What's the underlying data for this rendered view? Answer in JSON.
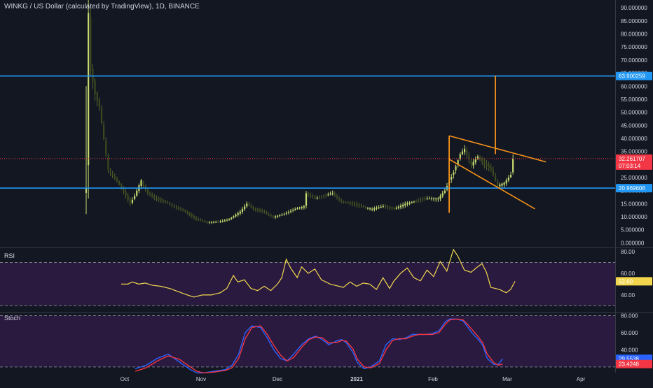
{
  "header": {
    "title": "WINKG / US Dollar (calculated by TradingView), 1D, BINANCE"
  },
  "panes": {
    "rsi_label": "RSI",
    "stoch_label": "Stoch"
  },
  "colors": {
    "background": "#131722",
    "bull": "#c5d86d",
    "bear": "#3b4a1e",
    "axis_text": "#d1d4dc",
    "hline": "#2196f3",
    "trend": "#f7931a",
    "current_price": "#f23645",
    "rsi_line": "#f2d74e",
    "osc_band": "#2a1a3f",
    "stoch_k": "#2962ff",
    "stoch_d": "#f23645"
  },
  "chart_data": [
    {
      "type": "candlestick",
      "title": "WINKG / US Dollar (calculated by TradingView), 1D, BINANCE",
      "ylim": [
        -1.5,
        93
      ],
      "x_ticks": [
        "Oct",
        "Nov",
        "Dec",
        "2021",
        "Feb",
        "Mar",
        "Apr"
      ],
      "y_ticks": [
        "90.000000",
        "85.000000",
        "80.000000",
        "75.000000",
        "70.000000",
        "65.000000",
        "60.000000",
        "55.000000",
        "50.000000",
        "45.000000",
        "40.000000",
        "35.000000",
        "30.000000",
        "25.000000",
        "20.000000",
        "15.000000",
        "10.000000",
        "5.000000",
        "0.000000"
      ],
      "close_anchors": [
        [
          0,
          21
        ],
        [
          1,
          88
        ],
        [
          2,
          66
        ],
        [
          4,
          57
        ],
        [
          6,
          52
        ],
        [
          8,
          40
        ],
        [
          10,
          28
        ],
        [
          13,
          25
        ],
        [
          16,
          21
        ],
        [
          18,
          18
        ],
        [
          20,
          15
        ],
        [
          22,
          18
        ],
        [
          25,
          24
        ],
        [
          28,
          19
        ],
        [
          31,
          17
        ],
        [
          35,
          16
        ],
        [
          40,
          14
        ],
        [
          45,
          12
        ],
        [
          50,
          9
        ],
        [
          55,
          8
        ],
        [
          60,
          8
        ],
        [
          65,
          9
        ],
        [
          70,
          12
        ],
        [
          73,
          15
        ],
        [
          76,
          13
        ],
        [
          80,
          12
        ],
        [
          85,
          10
        ],
        [
          90,
          11
        ],
        [
          95,
          13
        ],
        [
          99,
          14
        ],
        [
          100,
          19
        ],
        [
          104,
          17
        ],
        [
          108,
          18
        ],
        [
          112,
          19
        ],
        [
          116,
          16
        ],
        [
          120,
          15
        ],
        [
          125,
          14
        ],
        [
          130,
          13
        ],
        [
          135,
          14
        ],
        [
          140,
          13
        ],
        [
          145,
          15
        ],
        [
          150,
          16
        ],
        [
          155,
          17
        ],
        [
          160,
          17
        ],
        [
          163,
          20
        ],
        [
          167,
          27
        ],
        [
          170,
          34
        ],
        [
          172,
          36
        ],
        [
          175,
          30
        ],
        [
          178,
          33
        ],
        [
          181,
          30
        ],
        [
          184,
          28
        ],
        [
          187,
          22
        ],
        [
          190,
          23
        ],
        [
          193,
          26
        ],
        [
          194,
          32.26
        ]
      ],
      "high_anchors": [
        [
          0,
          60
        ],
        [
          1,
          94
        ],
        [
          2,
          90
        ]
      ],
      "low_anchors": [
        [
          0,
          11
        ],
        [
          1,
          17
        ]
      ],
      "horizontal_levels": [
        {
          "price": 63.900259,
          "label": "63.900259"
        },
        {
          "price": 20.969606,
          "label": "20.969606"
        }
      ],
      "current_price": {
        "price": 32.261707,
        "label": "32.261707",
        "countdown": "07:03:14"
      },
      "trend_lines": [
        {
          "from": [
            165,
            41
          ],
          "to": [
            209,
            31
          ]
        },
        {
          "from": [
            165,
            32
          ],
          "to": [
            204,
            13
          ]
        }
      ],
      "vertical_lines": [
        {
          "x": 165,
          "from": 11.5,
          "to": 41
        },
        {
          "x": 186,
          "from": 34,
          "to": 64
        }
      ]
    },
    {
      "type": "line",
      "name": "RSI",
      "ylim": [
        25,
        82
      ],
      "y_ticks": [
        "80.00",
        "60.00",
        "40.00"
      ],
      "levels": [
        70,
        30
      ],
      "value_label": "52.60",
      "anchors": [
        [
          0,
          50
        ],
        [
          3,
          50
        ],
        [
          5,
          52
        ],
        [
          8,
          50
        ],
        [
          11,
          51
        ],
        [
          14,
          49
        ],
        [
          18,
          48
        ],
        [
          22,
          46
        ],
        [
          26,
          43
        ],
        [
          30,
          40
        ],
        [
          33,
          38
        ],
        [
          37,
          40
        ],
        [
          41,
          40
        ],
        [
          45,
          42
        ],
        [
          48,
          46
        ],
        [
          51,
          58
        ],
        [
          53,
          52
        ],
        [
          56,
          54
        ],
        [
          59,
          46
        ],
        [
          62,
          44
        ],
        [
          65,
          48
        ],
        [
          68,
          44
        ],
        [
          71,
          50
        ],
        [
          73,
          56
        ],
        [
          75,
          73
        ],
        [
          77,
          65
        ],
        [
          80,
          56
        ],
        [
          82,
          66
        ],
        [
          85,
          60
        ],
        [
          88,
          64
        ],
        [
          91,
          54
        ],
        [
          95,
          50
        ],
        [
          99,
          48
        ],
        [
          101,
          47
        ],
        [
          104,
          52
        ],
        [
          107,
          48
        ],
        [
          110,
          51
        ],
        [
          113,
          50
        ],
        [
          116,
          45
        ],
        [
          119,
          56
        ],
        [
          122,
          46
        ],
        [
          124,
          53
        ],
        [
          127,
          60
        ],
        [
          130,
          65
        ],
        [
          133,
          56
        ],
        [
          136,
          53
        ],
        [
          139,
          63
        ],
        [
          142,
          57
        ],
        [
          145,
          71
        ],
        [
          148,
          62
        ],
        [
          151,
          82
        ],
        [
          153,
          76
        ],
        [
          156,
          63
        ],
        [
          159,
          61
        ],
        [
          162,
          66
        ],
        [
          164,
          69
        ],
        [
          166,
          61
        ],
        [
          168,
          47
        ],
        [
          170,
          46
        ],
        [
          172,
          45
        ],
        [
          175,
          42
        ],
        [
          177,
          45
        ],
        [
          179,
          52.6
        ]
      ]
    },
    {
      "type": "line",
      "name": "Stoch",
      "ylim": [
        15,
        82
      ],
      "y_ticks": [
        "80.000",
        "60.000",
        "40.000"
      ],
      "levels": [
        80,
        20
      ],
      "k_label": "29.5538",
      "d_label": "23.4248",
      "k_anchors": [
        [
          0,
          18
        ],
        [
          5,
          22
        ],
        [
          10,
          30
        ],
        [
          15,
          35
        ],
        [
          20,
          26
        ],
        [
          25,
          17
        ],
        [
          28,
          13
        ],
        [
          31,
          13
        ],
        [
          36,
          15
        ],
        [
          41,
          17
        ],
        [
          44,
          22
        ],
        [
          47,
          35
        ],
        [
          50,
          60
        ],
        [
          53,
          68
        ],
        [
          57,
          66
        ],
        [
          60,
          54
        ],
        [
          63,
          40
        ],
        [
          66,
          30
        ],
        [
          69,
          27
        ],
        [
          72,
          35
        ],
        [
          76,
          47
        ],
        [
          79,
          53
        ],
        [
          82,
          56
        ],
        [
          85,
          52
        ],
        [
          88,
          46
        ],
        [
          92,
          51
        ],
        [
          94,
          52
        ],
        [
          96,
          48
        ],
        [
          99,
          37
        ],
        [
          101,
          25
        ],
        [
          104,
          18
        ],
        [
          107,
          20
        ],
        [
          111,
          27
        ],
        [
          114,
          46
        ],
        [
          117,
          53
        ],
        [
          120,
          52
        ],
        [
          123,
          54
        ],
        [
          126,
          58
        ],
        [
          129,
          58
        ],
        [
          132,
          58
        ],
        [
          135,
          59
        ],
        [
          138,
          62
        ],
        [
          141,
          73
        ],
        [
          143,
          76
        ],
        [
          146,
          76
        ],
        [
          149,
          74
        ],
        [
          151,
          67
        ],
        [
          153,
          60
        ],
        [
          156,
          52
        ],
        [
          158,
          45
        ],
        [
          160,
          30
        ],
        [
          163,
          23
        ],
        [
          165,
          23
        ],
        [
          167,
          29.55
        ]
      ],
      "d_anchors": [
        [
          0,
          15
        ],
        [
          5,
          19
        ],
        [
          10,
          27
        ],
        [
          15,
          33
        ],
        [
          20,
          29
        ],
        [
          25,
          20
        ],
        [
          28,
          15
        ],
        [
          31,
          13
        ],
        [
          36,
          14
        ],
        [
          41,
          16
        ],
        [
          44,
          19
        ],
        [
          47,
          30
        ],
        [
          50,
          53
        ],
        [
          53,
          66
        ],
        [
          57,
          68
        ],
        [
          60,
          58
        ],
        [
          63,
          45
        ],
        [
          66,
          34
        ],
        [
          69,
          27
        ],
        [
          72,
          31
        ],
        [
          76,
          44
        ],
        [
          79,
          52
        ],
        [
          82,
          55
        ],
        [
          85,
          54
        ],
        [
          88,
          48
        ],
        [
          92,
          49
        ],
        [
          94,
          51
        ],
        [
          96,
          50
        ],
        [
          99,
          41
        ],
        [
          101,
          29
        ],
        [
          104,
          20
        ],
        [
          107,
          19
        ],
        [
          111,
          24
        ],
        [
          114,
          40
        ],
        [
          117,
          51
        ],
        [
          120,
          53
        ],
        [
          123,
          53
        ],
        [
          126,
          56
        ],
        [
          129,
          58
        ],
        [
          132,
          58
        ],
        [
          135,
          58
        ],
        [
          138,
          60
        ],
        [
          141,
          70
        ],
        [
          143,
          75
        ],
        [
          146,
          76
        ],
        [
          149,
          75
        ],
        [
          151,
          70
        ],
        [
          153,
          64
        ],
        [
          156,
          55
        ],
        [
          158,
          48
        ],
        [
          160,
          35
        ],
        [
          163,
          25
        ],
        [
          165,
          22
        ],
        [
          167,
          23.42
        ]
      ]
    }
  ]
}
